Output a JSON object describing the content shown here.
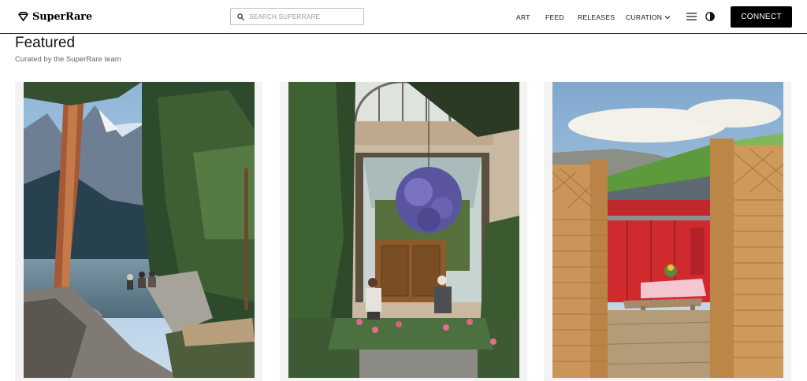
{
  "brand": {
    "name": "SuperRare",
    "logo_icon": "diamond-icon"
  },
  "search": {
    "placeholder": "SEARCH SUPERRARE",
    "value": ""
  },
  "nav": {
    "art": "ART",
    "feed": "FEED",
    "releases": "RELEASES",
    "curation": "CURATION"
  },
  "icons": {
    "menu": "hamburger-menu-icon",
    "theme": "contrast-toggle-icon",
    "search": "search-icon",
    "curation_caret": "chevron-down-icon"
  },
  "connect_label": "CONNECT",
  "featured": {
    "title": "Featured",
    "subtitle": "Curated by the SuperRare team",
    "artworks": [
      {
        "subject": "mountain-lake-forest"
      },
      {
        "subject": "conservatory-hanging-flowers"
      },
      {
        "subject": "wooden-fence-red-house"
      }
    ]
  },
  "colors": {
    "header_border": "#222222",
    "connect_bg": "#000000",
    "card_bg": "#f3f3f3"
  }
}
